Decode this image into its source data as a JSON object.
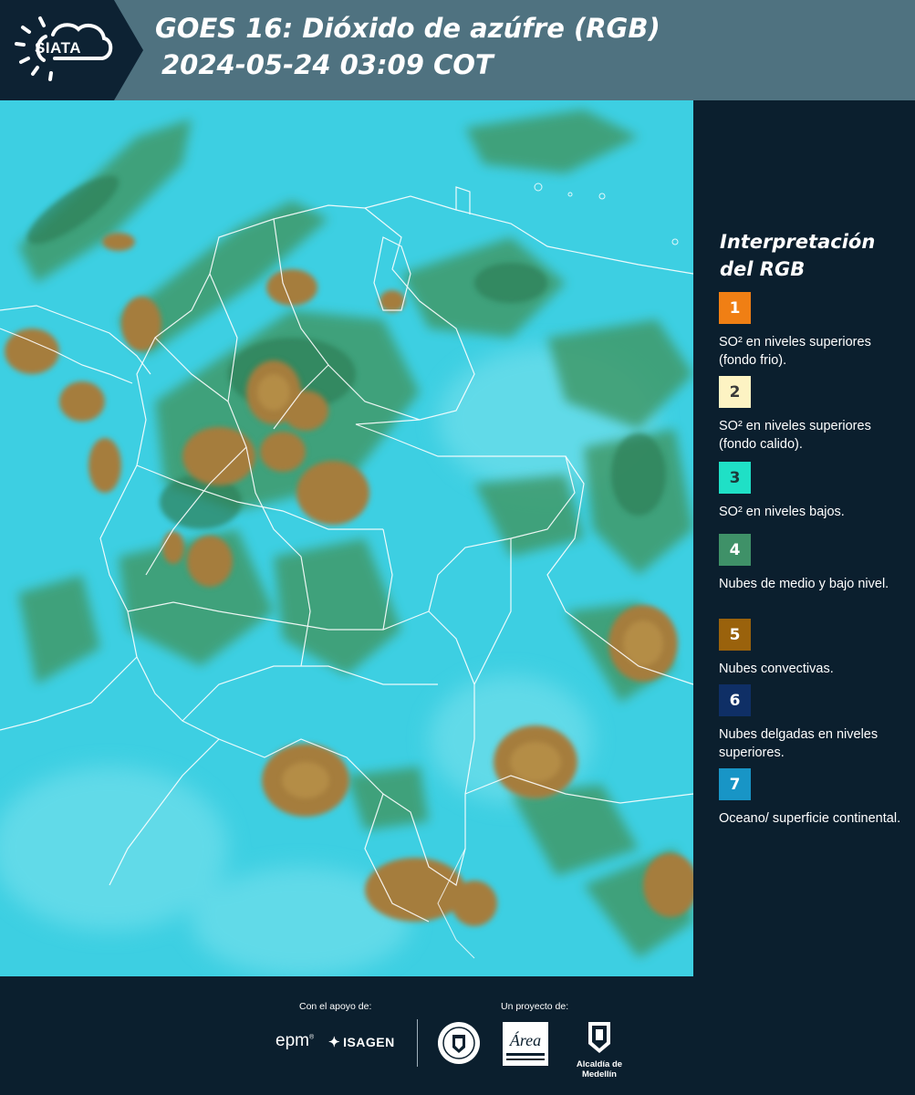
{
  "header": {
    "logo_text": "SIATA",
    "title_line_1": "GOES 16: Dióxido de azúfre (RGB)",
    "title_line_2": "2024-05-24 03:09 COT"
  },
  "legend": {
    "title": "Interpretación del RGB",
    "items": [
      {
        "number": "1",
        "label": "SO² en niveles superiores (fondo frio).",
        "color": "#f07f14",
        "text_color": "#ffffff"
      },
      {
        "number": "2",
        "label": "SO² en niveles superiores (fondo calido).",
        "color": "#fdf3c3",
        "text_color": "#3a3a3a"
      },
      {
        "number": "3",
        "label": "SO² en niveles bajos.",
        "color": "#1fe0c6",
        "text_color": "#1b3a3a"
      },
      {
        "number": "4",
        "label": "Nubes de medio y bajo nivel.",
        "color": "#3f9168",
        "text_color": "#ffffff"
      },
      {
        "number": "5",
        "label": "Nubes convectivas.",
        "color": "#9a620c",
        "text_color": "#ffffff"
      },
      {
        "number": "6",
        "label": "Nubes delgadas en niveles superiores.",
        "color": "#0f2f66",
        "text_color": "#ffffff"
      },
      {
        "number": "7",
        "label": "Oceano/ superficie continental.",
        "color": "#1895c6",
        "text_color": "#ffffff"
      }
    ]
  },
  "footer": {
    "support_caption": "Con el apoyo de:",
    "project_caption": "Un proyecto de:",
    "epm_logo": "epm",
    "isagen_logo": "ISAGEN",
    "metro_logo_text": "Área",
    "alcaldia_label": "Alcaldía de Medellín"
  },
  "map": {
    "ocean_color": "#32cde0",
    "convective_color": "#a57d3c",
    "green_cloud_color": "#3f9a6a",
    "border_color": "#ffffff"
  }
}
